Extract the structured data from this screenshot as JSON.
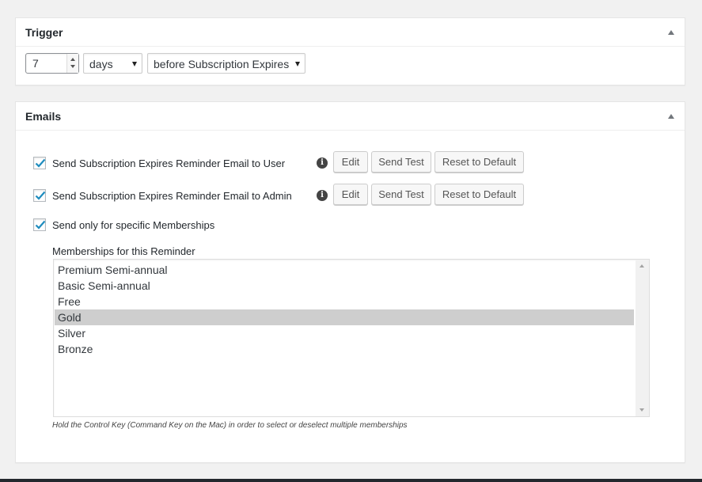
{
  "trigger": {
    "title": "Trigger",
    "number_value": "7",
    "unit_select": "days",
    "when_select": "before Subscription Expires"
  },
  "emails": {
    "title": "Emails",
    "rows": [
      {
        "label": "Send Subscription Expires Reminder Email to User",
        "checked": true,
        "edit": "Edit",
        "send_test": "Send Test",
        "reset": "Reset to Default"
      },
      {
        "label": "Send Subscription Expires Reminder Email to Admin",
        "checked": true,
        "edit": "Edit",
        "send_test": "Send Test",
        "reset": "Reset to Default"
      }
    ],
    "specific_memberships": {
      "label": "Send only for specific Memberships",
      "checked": true
    },
    "memberships_label": "Memberships for this Reminder",
    "memberships": [
      "Premium Semi-annual",
      "Basic Semi-annual",
      "Free",
      "Gold",
      "Silver",
      "Bronze"
    ],
    "selected_membership": "Gold",
    "hint": "Hold the Control Key (Command Key on the Mac) in order to select or deselect multiple memberships"
  },
  "icons": {
    "info": "info-icon",
    "checkmark": "checkmark-icon",
    "collapse": "collapse-arrow-icon"
  },
  "colors": {
    "checkmark": "#1e8cbe",
    "selected_row": "#cecece",
    "background": "#f1f1f1"
  }
}
